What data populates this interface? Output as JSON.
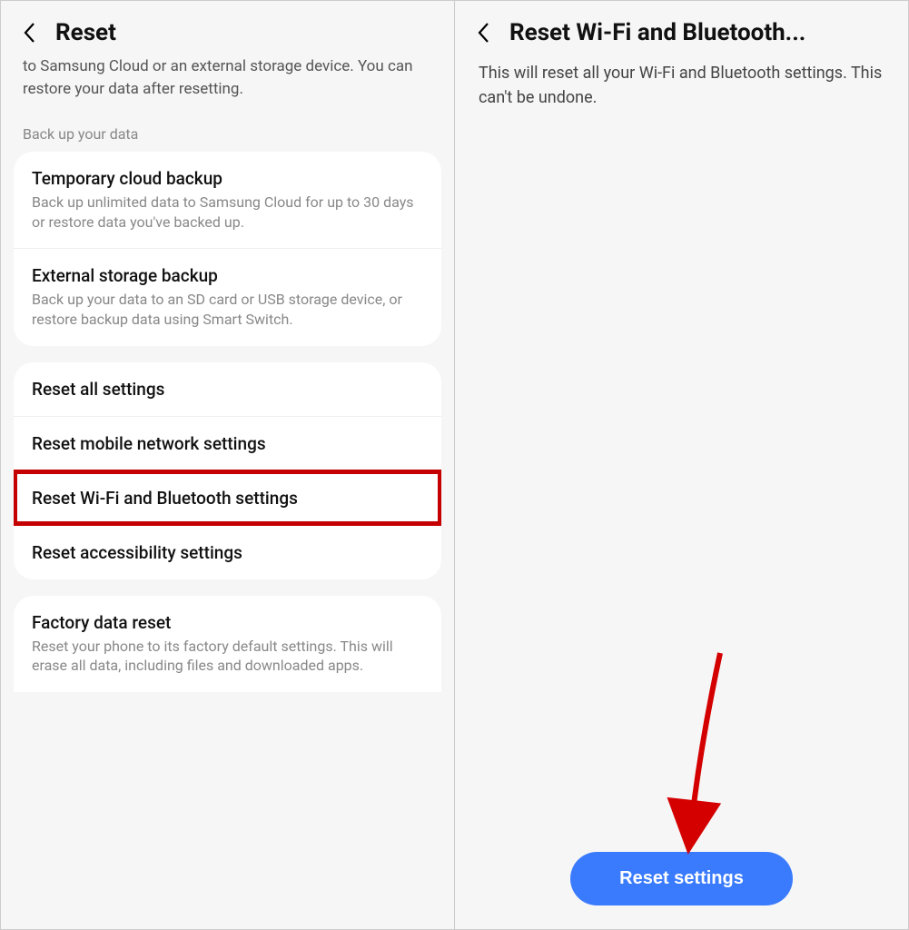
{
  "left": {
    "title": "Reset",
    "intro": "to Samsung Cloud or an external storage device. You can restore your data after resetting.",
    "section_label": "Back up your data",
    "backup_items": [
      {
        "title": "Temporary cloud backup",
        "sub": "Back up unlimited data to Samsung Cloud for up to 30 days or restore data you've backed up."
      },
      {
        "title": "External storage backup",
        "sub": "Back up your data to an SD card or USB storage device, or restore backup data using Smart Switch."
      }
    ],
    "reset_items": [
      {
        "title": "Reset all settings"
      },
      {
        "title": "Reset mobile network settings"
      },
      {
        "title": "Reset Wi-Fi and Bluetooth settings",
        "highlight": true
      },
      {
        "title": "Reset accessibility settings"
      }
    ],
    "factory": {
      "title": "Factory data reset",
      "sub": "Reset your phone to its factory default settings. This will erase all data, including files and downloaded apps."
    }
  },
  "right": {
    "title": "Reset Wi-Fi and Bluetooth...",
    "body": "This will reset all your Wi-Fi and Bluetooth settings. This can't be undone.",
    "button": "Reset settings"
  }
}
